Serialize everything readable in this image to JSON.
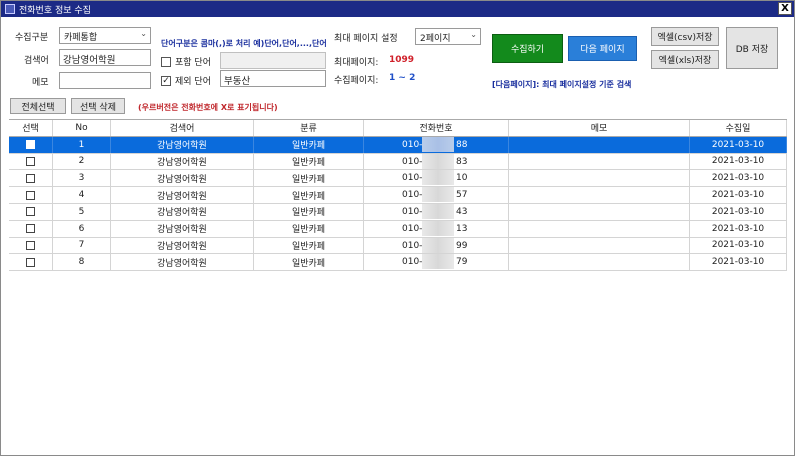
{
  "window": {
    "title": "전화번호 정보 수집",
    "close_label": "X"
  },
  "form": {
    "collect_type_label": "수집구분",
    "collect_type_value": "카페통합",
    "keyword_label": "검색어",
    "keyword_value": "강남영어학원",
    "memo_label": "메모",
    "memo_value": "",
    "keyword_note": "단어구분은 콤마(,)로 처리 예)단어,단어,...,단어",
    "include_word_label": "포함 단어",
    "include_word_checked": false,
    "include_word_value": "",
    "exclude_word_label": "제외 단어",
    "exclude_word_checked": true,
    "exclude_word_value": "부동산",
    "max_page_setting_label": "최대 페이지 설정",
    "max_page_setting_value": "2페이지",
    "max_page_label": "최대페이지:",
    "max_page_value": "1099",
    "collected_pages_label": "수집페이지:",
    "collected_pages_value": "1 ~ 2",
    "next_page_note": "[다음페이지]: 최대 페이지설정 기준 검색"
  },
  "buttons": {
    "collect": "수집하기",
    "next_page": "다음 페이지",
    "excel_csv": "엑셀(csv)저장",
    "excel_xls": "엑셀(xls)저장",
    "db_save": "DB 저장",
    "select_all": "전체선택",
    "delete_selected": "선택 삭제"
  },
  "grid_note": "(우르버전은 전화번호에 X로 표기됩니다)",
  "colors": {
    "title_bar": "#1c2a86",
    "collect_button": "#138a1c",
    "next_button": "#2a7fd9",
    "selected_row": "#0a6bdc"
  },
  "table": {
    "columns": [
      "선택",
      "No",
      "검색어",
      "분류",
      "전화번호",
      "메모",
      "수집일"
    ],
    "rows": [
      {
        "no": "1",
        "keyword": "강남영어학원",
        "category": "일반카페",
        "phone_prefix": "010-",
        "phone_suffix": "88",
        "memo": "",
        "date": "2021-03-10",
        "selected": true
      },
      {
        "no": "2",
        "keyword": "강남영어학원",
        "category": "일반카페",
        "phone_prefix": "010-",
        "phone_suffix": "83",
        "memo": "",
        "date": "2021-03-10",
        "selected": false
      },
      {
        "no": "3",
        "keyword": "강남영어학원",
        "category": "일반카페",
        "phone_prefix": "010-",
        "phone_suffix": "10",
        "memo": "",
        "date": "2021-03-10",
        "selected": false
      },
      {
        "no": "4",
        "keyword": "강남영어학원",
        "category": "일반카페",
        "phone_prefix": "010-",
        "phone_suffix": "57",
        "memo": "",
        "date": "2021-03-10",
        "selected": false
      },
      {
        "no": "5",
        "keyword": "강남영어학원",
        "category": "일반카페",
        "phone_prefix": "010-",
        "phone_suffix": "43",
        "memo": "",
        "date": "2021-03-10",
        "selected": false
      },
      {
        "no": "6",
        "keyword": "강남영어학원",
        "category": "일반카페",
        "phone_prefix": "010-",
        "phone_suffix": "13",
        "memo": "",
        "date": "2021-03-10",
        "selected": false
      },
      {
        "no": "7",
        "keyword": "강남영어학원",
        "category": "일반카페",
        "phone_prefix": "010-",
        "phone_suffix": "99",
        "memo": "",
        "date": "2021-03-10",
        "selected": false
      },
      {
        "no": "8",
        "keyword": "강남영어학원",
        "category": "일반카페",
        "phone_prefix": "010-",
        "phone_suffix": "79",
        "memo": "",
        "date": "2021-03-10",
        "selected": false
      }
    ]
  }
}
